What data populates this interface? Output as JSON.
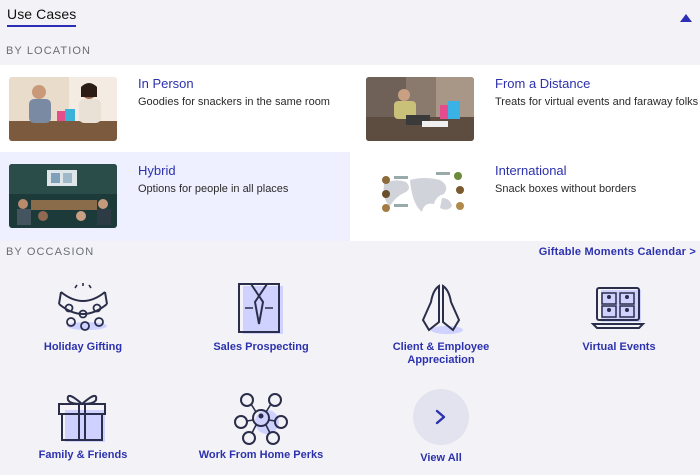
{
  "header": {
    "title": "Use Cases"
  },
  "sections": {
    "location_label": "BY LOCATION",
    "occasion_label": "BY OCCASION",
    "calendar_link": "Giftable Moments Calendar >"
  },
  "locations": [
    {
      "title": "In Person",
      "desc": "Goodies for snackers in the same room"
    },
    {
      "title": "From a Distance",
      "desc": "Treats for virtual events and faraway folks"
    },
    {
      "title": "Hybrid",
      "desc": "Options for people in all places"
    },
    {
      "title": "International",
      "desc": "Snack boxes without borders"
    }
  ],
  "occasions": [
    {
      "label": "Holiday Gifting",
      "icon": "string-lights-icon"
    },
    {
      "label": "Sales Prospecting",
      "icon": "shirt-tie-icon"
    },
    {
      "label": "Client & Employee Appreciation",
      "icon": "praying-hands-icon"
    },
    {
      "label": "Virtual Events",
      "icon": "video-call-laptop-icon"
    },
    {
      "label": "Family & Friends",
      "icon": "gift-box-icon"
    },
    {
      "label": "Work From Home Perks",
      "icon": "people-network-icon"
    },
    {
      "label": "View All",
      "icon": "chevron-right-icon"
    }
  ],
  "colors": {
    "accent": "#2c31ad",
    "background": "#f3f3f7",
    "active_card": "#eef0ff",
    "icon_stroke": "#2b2e4a",
    "icon_fill": "#cfd1ff"
  }
}
